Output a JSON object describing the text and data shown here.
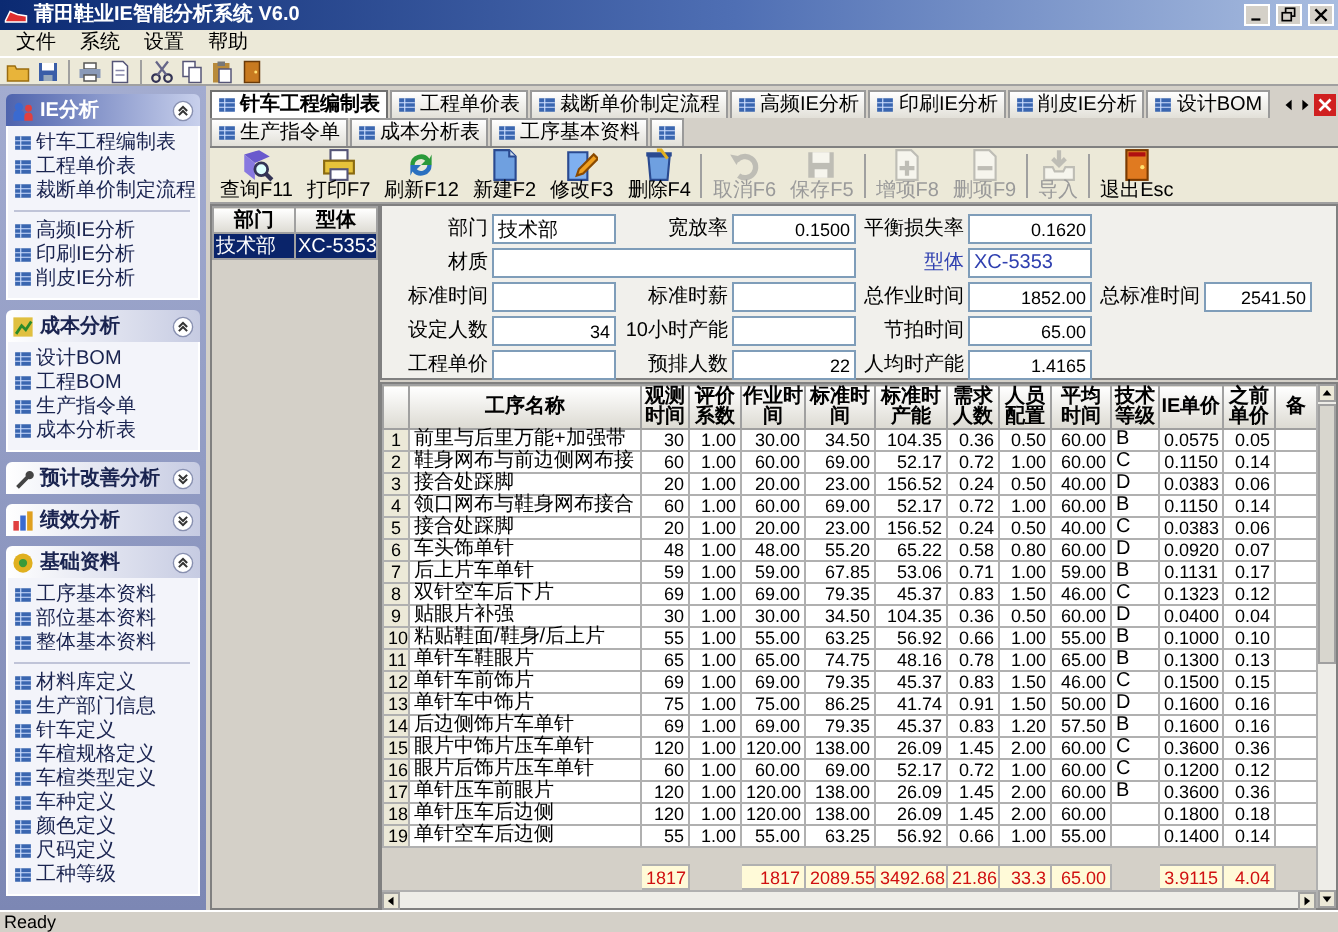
{
  "window": {
    "title": "莆田鞋业IE智能分析系统 V6.0"
  },
  "menu": [
    "文件",
    "系统",
    "设置",
    "帮助"
  ],
  "sidebar": {
    "groups": [
      {
        "title": "IE分析",
        "selected": true,
        "expanded": true,
        "sections": [
          [
            "针车工程编制表",
            "工程单价表",
            "裁断单价制定流程"
          ],
          [
            "高频IE分析",
            "印刷IE分析",
            "削皮IE分析"
          ]
        ]
      },
      {
        "title": "成本分析",
        "selected": false,
        "expanded": true,
        "sections": [
          [
            "设计BOM",
            "工程BOM",
            "生产指令单",
            "成本分析表"
          ]
        ]
      },
      {
        "title": "预计改善分析",
        "selected": false,
        "expanded": false
      },
      {
        "title": "绩效分析",
        "selected": false,
        "expanded": false
      },
      {
        "title": "基础资料",
        "selected": false,
        "expanded": true,
        "sections": [
          [
            "工序基本资料",
            "部位基本资料",
            "整体基本资料"
          ],
          [
            "材料库定义",
            "生产部门信息",
            "针车定义",
            "车楦规格定义",
            "车楦类型定义",
            "车种定义",
            "颜色定义",
            "尺码定义",
            "工种等级"
          ]
        ]
      }
    ]
  },
  "tabs": [
    {
      "label": "针车工程编制表",
      "selected": true
    },
    {
      "label": "工程单价表",
      "selected": false
    },
    {
      "label": "裁断单价制定流程",
      "selected": false
    },
    {
      "label": "高频IE分析",
      "selected": false
    },
    {
      "label": "印刷IE分析",
      "selected": false
    },
    {
      "label": "削皮IE分析",
      "selected": false
    },
    {
      "label": "设计BOM",
      "selected": false
    },
    {
      "label": "生产指令单",
      "selected": false
    },
    {
      "label": "成本分析表",
      "selected": false
    },
    {
      "label": "工序基本资料",
      "selected": false
    }
  ],
  "actions": [
    {
      "label": "查询F11",
      "kind": "search",
      "disabled": false
    },
    {
      "label": "打印F7",
      "kind": "print",
      "disabled": false
    },
    {
      "label": "刷新F12",
      "kind": "refresh",
      "disabled": false
    },
    {
      "label": "新建F2",
      "kind": "new",
      "disabled": false
    },
    {
      "label": "修改F3",
      "kind": "edit",
      "disabled": false
    },
    {
      "label": "删除F4",
      "kind": "delete",
      "disabled": false
    },
    {
      "label": "取消F6",
      "kind": "undo",
      "disabled": true
    },
    {
      "label": "保存F5",
      "kind": "save",
      "disabled": true
    },
    {
      "label": "增项F8",
      "kind": "add",
      "disabled": true
    },
    {
      "label": "删项F9",
      "kind": "remove",
      "disabled": true
    },
    {
      "label": "导入",
      "kind": "import",
      "disabled": true
    },
    {
      "label": "退出Esc",
      "kind": "exit",
      "disabled": false
    }
  ],
  "list": {
    "columns": [
      "部门",
      "型体"
    ],
    "rows": [
      {
        "cells": [
          "技术部",
          "XC-5353"
        ],
        "selected": true
      }
    ]
  },
  "form": {
    "rows": [
      [
        {
          "label": "部门",
          "value": "技术部",
          "kind": "text"
        },
        {
          "label": "宽放率",
          "value": "0.1500",
          "kind": "number"
        },
        {
          "label": "平衡损失率",
          "value": "0.1620",
          "kind": "number"
        }
      ],
      [
        {
          "label": "材质",
          "kind": "wide"
        },
        {
          "kind": "continued"
        },
        {
          "label": "型体",
          "value": "XC-5353",
          "kind": "lookup"
        }
      ],
      [
        {
          "label": "标准时间",
          "kind": "text"
        },
        {
          "label": "标准时薪",
          "kind": "text"
        },
        {
          "label": "总作业时间",
          "value": "1852.00",
          "kind": "number"
        },
        {
          "label": "总标准时间",
          "value": "2541.50",
          "kind": "number"
        }
      ],
      [
        {
          "label": "设定人数",
          "value": "34",
          "kind": "number"
        },
        {
          "label": "10小时产能",
          "kind": "text"
        },
        {
          "label": "节拍时间",
          "value": "65.00",
          "kind": "number"
        }
      ],
      [
        {
          "label": "工程单价",
          "kind": "text"
        },
        {
          "label": "预排人数",
          "value": "22",
          "kind": "number"
        },
        {
          "label": "人均时产能",
          "value": "1.4165",
          "kind": "number"
        }
      ]
    ]
  },
  "grid": {
    "columns": [
      {
        "label": "工序名称",
        "kind": "text"
      },
      {
        "label": "观测时间",
        "kind": "number"
      },
      {
        "label": "评价系数",
        "kind": "number"
      },
      {
        "label": "作业时间",
        "kind": "number"
      },
      {
        "label": "标准时间",
        "kind": "number"
      },
      {
        "label": "标准时产能",
        "kind": "number"
      },
      {
        "label": "需求人数",
        "kind": "number"
      },
      {
        "label": "人员配置",
        "kind": "number"
      },
      {
        "label": "平均时间",
        "kind": "number"
      },
      {
        "label": "技术等级",
        "kind": "text"
      },
      {
        "label": "IE单价",
        "kind": "number"
      },
      {
        "label": "之前单价",
        "kind": "number"
      },
      {
        "label": "备",
        "kind": "text"
      }
    ],
    "rows": [
      {
        "no": "1",
        "cells": [
          "前里与后里万能+加强带",
          "30",
          "1.00",
          "30.00",
          "34.50",
          "104.35",
          "0.36",
          "0.50",
          "60.00",
          "B",
          "0.0575",
          "0.05",
          null
        ]
      },
      {
        "no": "2",
        "cells": [
          "鞋身网布与前边侧网布接",
          "60",
          "1.00",
          "60.00",
          "69.00",
          "52.17",
          "0.72",
          "1.00",
          "60.00",
          "C",
          "0.1150",
          "0.14",
          null
        ]
      },
      {
        "no": "3",
        "cells": [
          "接合处踩脚",
          "20",
          "1.00",
          "20.00",
          "23.00",
          "156.52",
          "0.24",
          "0.50",
          "40.00",
          "D",
          "0.0383",
          "0.06",
          null
        ]
      },
      {
        "no": "4",
        "cells": [
          "领口网布与鞋身网布接合",
          "60",
          "1.00",
          "60.00",
          "69.00",
          "52.17",
          "0.72",
          "1.00",
          "60.00",
          "B",
          "0.1150",
          "0.14",
          null
        ]
      },
      {
        "no": "5",
        "cells": [
          "接合处踩脚",
          "20",
          "1.00",
          "20.00",
          "23.00",
          "156.52",
          "0.24",
          "0.50",
          "40.00",
          "C",
          "0.0383",
          "0.06",
          null
        ]
      },
      {
        "no": "6",
        "cells": [
          "车头饰单针",
          "48",
          "1.00",
          "48.00",
          "55.20",
          "65.22",
          "0.58",
          "0.80",
          "60.00",
          "D",
          "0.0920",
          "0.07",
          null
        ]
      },
      {
        "no": "7",
        "cells": [
          "后上片车单针",
          "59",
          "1.00",
          "59.00",
          "67.85",
          "53.06",
          "0.71",
          "1.00",
          "59.00",
          "B",
          "0.1131",
          "0.17",
          null
        ]
      },
      {
        "no": "8",
        "cells": [
          "双针空车后下片",
          "69",
          "1.00",
          "69.00",
          "79.35",
          "45.37",
          "0.83",
          "1.50",
          "46.00",
          "C",
          "0.1323",
          "0.12",
          null
        ]
      },
      {
        "no": "9",
        "cells": [
          "贴眼片补强",
          "30",
          "1.00",
          "30.00",
          "34.50",
          "104.35",
          "0.36",
          "0.50",
          "60.00",
          "D",
          "0.0400",
          "0.04",
          null
        ]
      },
      {
        "no": "10",
        "cells": [
          "粘贴鞋面/鞋身/后上片",
          "55",
          "1.00",
          "55.00",
          "63.25",
          "56.92",
          "0.66",
          "1.00",
          "55.00",
          "B",
          "0.1000",
          "0.10",
          null
        ]
      },
      {
        "no": "11",
        "cells": [
          "单针车鞋眼片",
          "65",
          "1.00",
          "65.00",
          "74.75",
          "48.16",
          "0.78",
          "1.00",
          "65.00",
          "B",
          "0.1300",
          "0.13",
          null
        ]
      },
      {
        "no": "12",
        "cells": [
          "单针车前饰片",
          "69",
          "1.00",
          "69.00",
          "79.35",
          "45.37",
          "0.83",
          "1.50",
          "46.00",
          "C",
          "0.1500",
          "0.15",
          null
        ]
      },
      {
        "no": "13",
        "cells": [
          "单针车中饰片",
          "75",
          "1.00",
          "75.00",
          "86.25",
          "41.74",
          "0.91",
          "1.50",
          "50.00",
          "D",
          "0.1600",
          "0.16",
          null
        ]
      },
      {
        "no": "14",
        "cells": [
          "后边侧饰片车单针",
          "69",
          "1.00",
          "69.00",
          "79.35",
          "45.37",
          "0.83",
          "1.20",
          "57.50",
          "B",
          "0.1600",
          "0.16",
          null
        ]
      },
      {
        "no": "15",
        "cells": [
          "眼片中饰片压车单针",
          "120",
          "1.00",
          "120.00",
          "138.00",
          "26.09",
          "1.45",
          "2.00",
          "60.00",
          "C",
          "0.3600",
          "0.36",
          null
        ]
      },
      {
        "no": "16",
        "cells": [
          "眼片后饰片压车单针",
          "60",
          "1.00",
          "60.00",
          "69.00",
          "52.17",
          "0.72",
          "1.00",
          "60.00",
          "C",
          "0.1200",
          "0.12",
          null
        ]
      },
      {
        "no": "17",
        "cells": [
          "单针压车前眼片",
          "120",
          "1.00",
          "120.00",
          "138.00",
          "26.09",
          "1.45",
          "2.00",
          "60.00",
          "B",
          "0.3600",
          "0.36",
          null
        ]
      },
      {
        "no": "18",
        "cells": [
          "单针压车后边侧",
          "120",
          "1.00",
          "120.00",
          "138.00",
          "26.09",
          "1.45",
          "2.00",
          "60.00",
          null,
          "0.1800",
          "0.18",
          null
        ]
      },
      {
        "no": "19",
        "cells": [
          "单针空车后边侧",
          "55",
          "1.00",
          "55.00",
          "63.25",
          "56.92",
          "0.66",
          "1.00",
          "55.00",
          null,
          "0.1400",
          "0.14",
          null
        ]
      }
    ],
    "totals": [
      {
        "kind": "empty"
      },
      {
        "kind": "sum",
        "value": "1817"
      },
      {
        "kind": "empty"
      },
      {
        "kind": "sum",
        "value": "1817"
      },
      {
        "kind": "sum",
        "value": "2089.55"
      },
      {
        "kind": "sum",
        "value": "3492.68"
      },
      {
        "kind": "sum",
        "value": "21.86"
      },
      {
        "kind": "sum",
        "value": "33.3"
      },
      {
        "kind": "sum",
        "value": "65.00"
      },
      {
        "kind": "empty"
      },
      {
        "kind": "sum",
        "value": "3.9115"
      },
      {
        "kind": "sum",
        "value": "4.04"
      },
      {
        "kind": "empty"
      }
    ]
  },
  "status_bar": "Ready"
}
